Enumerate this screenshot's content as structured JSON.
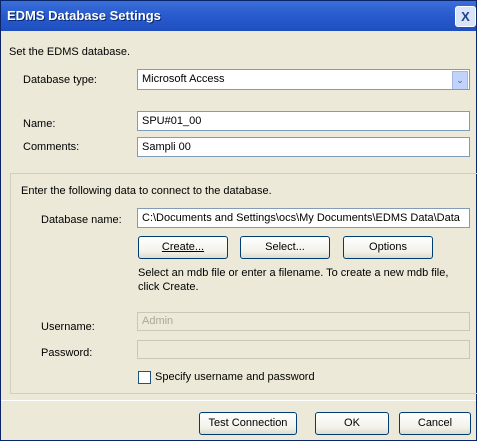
{
  "window": {
    "title": "EDMS Database Settings",
    "close_glyph": "X"
  },
  "intro": "Set the EDMS database.",
  "db_type": {
    "label": "Database type:",
    "value": "Microsoft Access",
    "arrow": "⌄"
  },
  "name": {
    "label": "Name:",
    "value": "SPU#01_00"
  },
  "comments": {
    "label": "Comments:",
    "value": "Sampli 00"
  },
  "connect": {
    "instruction": "Enter the following data to connect to the database.",
    "db_name_label": "Database name:",
    "db_name_value": "C:\\Documents and Settings\\ocs\\My Documents\\EDMS Data\\Data",
    "create_label": "Create...",
    "select_label": "Select...",
    "options_label": "Options",
    "hint_line1": "Select an mdb file or enter a filename. To create a new mdb file,",
    "hint_line2": "click Create.",
    "username_label": "Username:",
    "username_value": "Admin",
    "password_label": "Password:",
    "password_value": "",
    "specify_label": "Specify username and password"
  },
  "footer": {
    "test_label": "Test Connection",
    "ok_label": "OK",
    "cancel_label": "Cancel"
  }
}
